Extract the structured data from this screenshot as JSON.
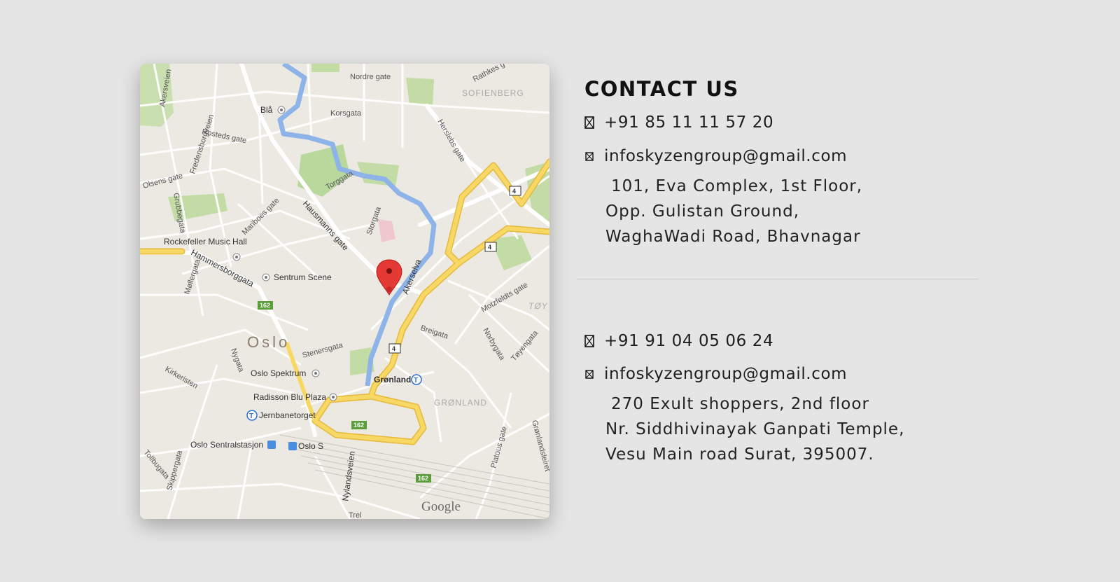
{
  "contact": {
    "title": "CONTACT US",
    "locations": [
      {
        "phone": "+91 85 11 11 57 20",
        "email": "infoskyzengroup@gmail.com",
        "address_lines": [
          "101, Eva Complex, 1st Floor,",
          "Opp. Gulistan Ground,",
          "WaghaWadi Road, Bhavnagar"
        ]
      },
      {
        "phone": "+91 91 04 05 06 24",
        "email": "infoskyzengroup@gmail.com",
        "address_lines": [
          "270 Exult shoppers, 2nd floor",
          "Nr. Siddhivinayak Ganpati Temple,",
          "Vesu Main road Surat, 395007."
        ]
      }
    ],
    "icons": {
      "phone": "phone-icon",
      "email": "email-icon"
    }
  },
  "map": {
    "city": "Oslo",
    "attribution": "Google",
    "colors": {
      "land": "#ece9e2",
      "park": "#b8d89c",
      "water": "#8db3e8",
      "road": "#ffffff",
      "highway": "#f8d865",
      "marker": "#e53935"
    },
    "streets": [
      "Nordre gate",
      "Rathkes g",
      "Akersveien",
      "Korsgata",
      "Fredensborgveien",
      "Rosteds gate",
      "Olsens gate",
      "Torggata",
      "Herslebs gate",
      "Grubbegata",
      "Mariboes gate",
      "Hausmanns gate",
      "Storgata",
      "Hammersborggata",
      "Møllergata",
      "Akerselva",
      "Motzfeldts gate",
      "Breigata",
      "Norbygata",
      "Nygata",
      "Stenersgata",
      "Kirkeristen",
      "Tøyengata",
      "Nylandsveien",
      "Platous gate",
      "Grønlandsleiret",
      "Skippergata",
      "Tollbugata",
      "Trel"
    ],
    "areas": [
      "SOFIENBERG",
      "GRØNLAND",
      "TØY"
    ],
    "places": [
      "Blå",
      "Rockefeller Music Hall",
      "Sentrum Scene",
      "Oslo Spektrum",
      "Grønland",
      "Radisson Blu Plaza",
      "Jernbanetorget",
      "Oslo Sentralstasjon",
      "Oslo S"
    ],
    "route_shields": [
      "4",
      "4",
      "162",
      "4",
      "162",
      "162"
    ]
  }
}
